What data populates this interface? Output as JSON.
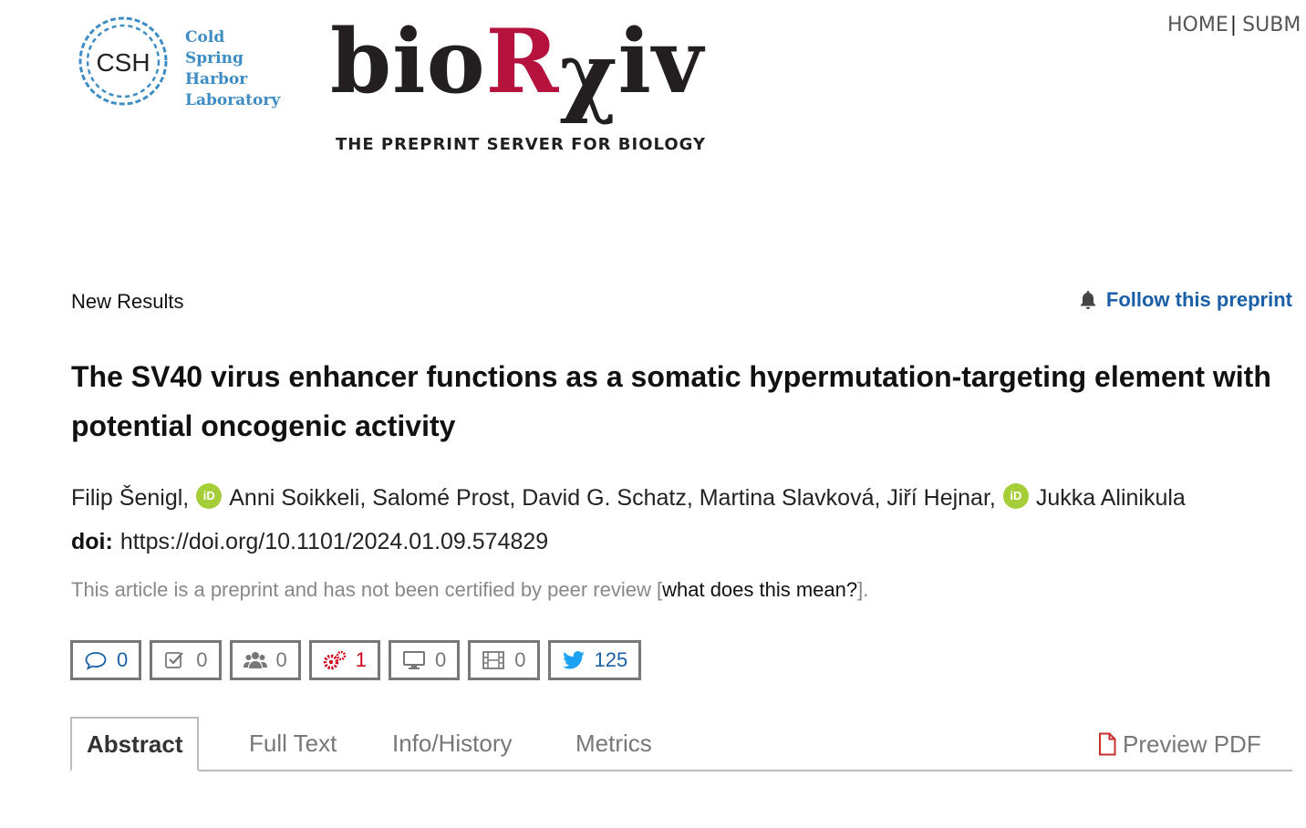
{
  "header": {
    "csh_logo": {
      "monogram": "CSH",
      "lines": [
        "Cold",
        "Spring",
        "Harbor",
        "Laboratory"
      ]
    },
    "site_logo": {
      "bio": "bio",
      "r": "R",
      "chi": "χ",
      "iv": "iv",
      "tagline": "THE PREPRINT SERVER FOR BIOLOGY"
    },
    "nav": {
      "home": "HOME",
      "separator": "|",
      "submit": "SUBM"
    }
  },
  "article": {
    "category": "New Results",
    "follow_label": "Follow this preprint",
    "title": "The SV40 virus enhancer functions as a somatic hypermutation-targeting element with potential oncogenic activity",
    "authors": [
      "Filip Šenigl,",
      "Anni Soikkeli, Salomé Prost, David G. Schatz, Martina Slavková, Jiří Hejnar,",
      "Jukka Alinikula"
    ],
    "orcid_label": "iD",
    "doi_label": "doi:",
    "doi_value": "https://doi.org/10.1101/2024.01.09.574829",
    "notice_text": "This article is a preprint and has not been certified by peer review [",
    "notice_link": "what does this mean?",
    "notice_end": "]."
  },
  "badges": [
    {
      "icon": "comment-icon",
      "count": "0"
    },
    {
      "icon": "checkbox-icon",
      "count": "0"
    },
    {
      "icon": "users-icon",
      "count": "0"
    },
    {
      "icon": "gears-icon",
      "count": "1"
    },
    {
      "icon": "monitor-icon",
      "count": "0"
    },
    {
      "icon": "film-icon",
      "count": "0"
    },
    {
      "icon": "twitter-icon",
      "count": "125"
    }
  ],
  "tabs": {
    "abstract": "Abstract",
    "full_text": "Full Text",
    "info_history": "Info/History",
    "metrics": "Metrics",
    "preview_pdf": "Preview PDF"
  },
  "colors": {
    "link_blue": "#1a5fa7",
    "brand_red": "#b5123d",
    "orcid_green": "#a6ce39",
    "csh_blue": "#3d8cc4",
    "badge_red": "#d0021b",
    "twitter_blue": "#1da1f2"
  }
}
